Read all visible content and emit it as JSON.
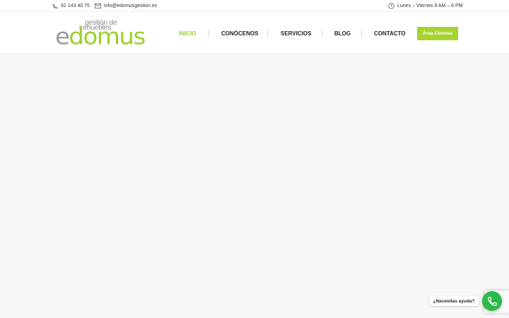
{
  "topbar": {
    "phone": "91 143 40 75",
    "email": "info@edomusgestion.es",
    "hours": "Lunes – Viernes 9 AM – 6 PM"
  },
  "logo": {
    "word": "edomus",
    "word_first": "e",
    "word_rest": "domus",
    "sub_line1": "gestión de",
    "sub_line2": "inmuebles"
  },
  "nav": {
    "items": [
      {
        "label": "INICIO",
        "active": true
      },
      {
        "label": "CONÓCENOS",
        "active": false
      },
      {
        "label": "SERVICIOS",
        "active": false
      },
      {
        "label": "BLOG",
        "active": false
      },
      {
        "label": "CONTACTO",
        "active": false
      }
    ],
    "client_button": "Área Clientes"
  },
  "widgets": {
    "help_text": "¿Necesitas ayuda?"
  },
  "colors": {
    "accent": "#9bd02a",
    "button": "#a5d431",
    "phone_fab": "#2db84c",
    "logo_grey": "#9a9a9a"
  },
  "icons": {
    "phone": "phone-icon",
    "email": "envelope-icon",
    "hours": "clock-icon",
    "call_fab": "phone-icon"
  }
}
